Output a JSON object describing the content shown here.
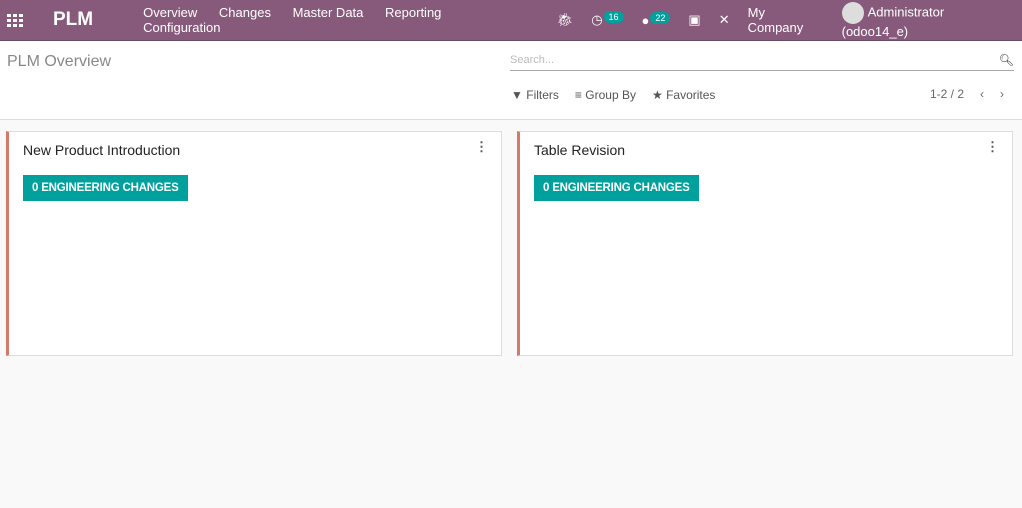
{
  "navbar": {
    "app_name": "PLM",
    "menu": [
      "Overview",
      "Changes",
      "Master Data",
      "Reporting",
      "Configuration"
    ],
    "activity_count": "16",
    "message_count": "22",
    "company": "My Company",
    "user": "Administrator (odoo14_e)",
    "brand_color": "#875a7b"
  },
  "control_panel": {
    "title": "PLM Overview",
    "search_placeholder": "Search...",
    "filters": "Filters",
    "group_by": "Group By",
    "favorites": "Favorites",
    "pager": "1-2 / 2"
  },
  "cards": [
    {
      "name": "New Product Introduction",
      "button": "0 ENGINEERING CHANGES"
    },
    {
      "name": "Table Revision",
      "button": "0 ENGINEERING CHANGES"
    }
  ],
  "accent_color": "#00a09d"
}
